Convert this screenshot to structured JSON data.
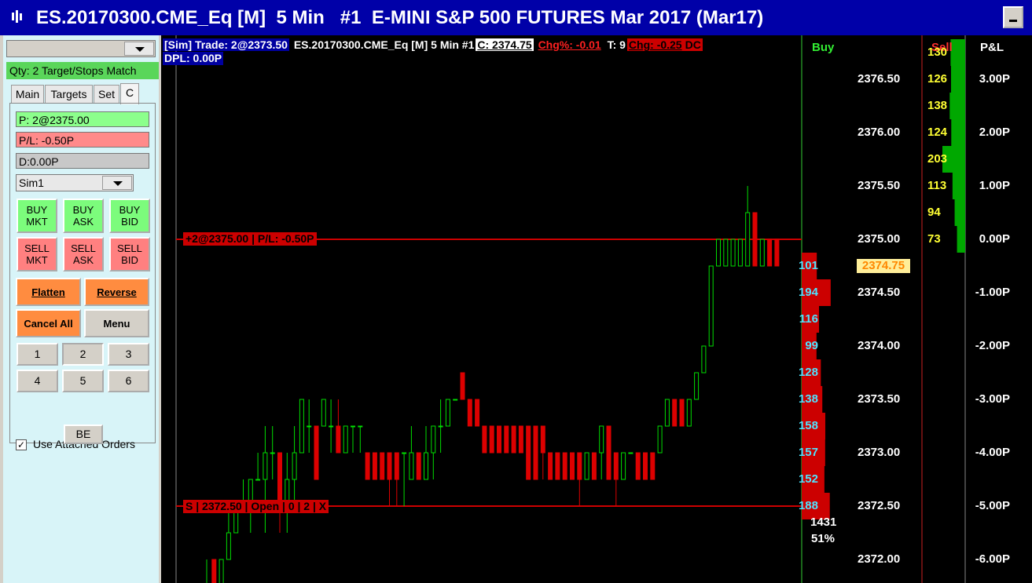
{
  "title": {
    "text": "ES.20170300.CME_Eq [M]  5 Min   #1  E-MINI S&P 500 FUTURES Mar 2017 (Mar17)"
  },
  "panel": {
    "qty_bar": "Qty: 2 Target/Stops Match",
    "tabs": [
      "Main",
      "Targets",
      "Set",
      "C"
    ],
    "position": "P: 2@2375.00",
    "pl": "P/L: -0.50P",
    "daily": "D:0.00P",
    "account": "Sim1",
    "buttons": {
      "buy_mkt": "BUY\nMKT",
      "buy_ask": "BUY\nASK",
      "buy_bid": "BUY\nBID",
      "sell_mkt": "SELL\nMKT",
      "sell_ask": "SELL\nASK",
      "sell_bid": "SELL\nBID",
      "flatten": "Flatten",
      "reverse": "Reverse",
      "cancel_all": "Cancel All",
      "menu": "Menu",
      "be": "BE"
    },
    "numbers": [
      "1",
      "2",
      "3",
      "4",
      "5",
      "6"
    ],
    "use_attached": "Use Attached Orders",
    "checkmark": "✓"
  },
  "chart": {
    "info": {
      "sim": "[Sim]",
      "trade": "Trade: 2@2373.50",
      "symbol": "ES.20170300.CME_Eq [M]  5 Min   #1",
      "close": "C: 2374.75",
      "chg_pct": "Chg%: -0.01",
      "ticks": "T: 9",
      "chg": "Chg: -0.25",
      "dc": "DC",
      "dpl": "DPL: 0.00P"
    },
    "position_line_label": "+2@2375.00 | P/L: -0.50P",
    "stop_line_label": "S | 2372.50 | Open | 0 | 2 | X",
    "headers": {
      "buy": "Buy",
      "sell": "Sell",
      "pnl": "P&L"
    },
    "current_price": "2374.75",
    "volume_total": "1431",
    "volume_pct": "51%",
    "colors": {
      "up": "#00dd00",
      "down": "#dd0000",
      "position_line": "#cc0000",
      "buy_volume": "#cc0000",
      "sell_volume": "#00a800"
    }
  },
  "chart_data": {
    "type": "candlestick",
    "price_ticks": [
      "2376.50",
      "2376.00",
      "2375.50",
      "2375.00",
      "2374.50",
      "2374.00",
      "2373.50",
      "2373.00",
      "2372.50",
      "2372.00"
    ],
    "pnl_ticks": [
      "3.00P",
      "2.00P",
      "1.00P",
      "0.00P",
      "-1.00P",
      "-2.00P",
      "-3.00P",
      "-4.00P",
      "-5.00P",
      "-6.00P"
    ],
    "buy_volume": [
      {
        "price": 2374.75,
        "volume": 101
      },
      {
        "price": 2374.5,
        "volume": 194
      },
      {
        "price": 2374.25,
        "volume": 116
      },
      {
        "price": 2374.0,
        "volume": 99
      },
      {
        "price": 2373.75,
        "volume": 128
      },
      {
        "price": 2373.5,
        "volume": 138
      },
      {
        "price": 2373.25,
        "volume": 158
      },
      {
        "price": 2373.0,
        "volume": 157
      },
      {
        "price": 2372.75,
        "volume": 152
      },
      {
        "price": 2372.5,
        "volume": 188
      }
    ],
    "sell_volume": [
      {
        "price": 2376.75,
        "volume": 130
      },
      {
        "price": 2376.5,
        "volume": 126
      },
      {
        "price": 2376.25,
        "volume": 138
      },
      {
        "price": 2376.0,
        "volume": 124
      },
      {
        "price": 2375.75,
        "volume": 203
      },
      {
        "price": 2375.5,
        "volume": 113
      },
      {
        "price": 2375.25,
        "volume": 94
      },
      {
        "price": 2375.0,
        "volume": 73
      }
    ],
    "position_price": 2375.0,
    "stop_price": 2372.5,
    "candles": [
      {
        "o": 2371.75,
        "h": 2372.0,
        "l": 2371.75,
        "c": 2371.75
      },
      {
        "o": 2372.0,
        "h": 2372.0,
        "l": 2371.75,
        "c": 2371.75
      },
      {
        "o": 2371.75,
        "h": 2372.0,
        "l": 2371.75,
        "c": 2372.0
      },
      {
        "o": 2372.0,
        "h": 2372.5,
        "l": 2372.0,
        "c": 2372.25
      },
      {
        "o": 2372.25,
        "h": 2372.5,
        "l": 2372.25,
        "c": 2372.5
      },
      {
        "o": 2372.5,
        "h": 2372.75,
        "l": 2372.5,
        "c": 2372.5
      },
      {
        "o": 2372.5,
        "h": 2372.75,
        "l": 2372.25,
        "c": 2372.75
      },
      {
        "o": 2372.75,
        "h": 2373.0,
        "l": 2372.75,
        "c": 2372.75
      },
      {
        "o": 2372.75,
        "h": 2373.25,
        "l": 2372.25,
        "c": 2373.0
      },
      {
        "o": 2373.0,
        "h": 2373.25,
        "l": 2372.75,
        "c": 2373.0
      },
      {
        "o": 2373.0,
        "h": 2373.0,
        "l": 2372.25,
        "c": 2372.5
      },
      {
        "o": 2372.5,
        "h": 2373.0,
        "l": 2372.25,
        "c": 2372.75
      },
      {
        "o": 2372.75,
        "h": 2373.25,
        "l": 2372.5,
        "c": 2373.0
      },
      {
        "o": 2373.0,
        "h": 2373.5,
        "l": 2373.0,
        "c": 2373.5
      },
      {
        "o": 2373.25,
        "h": 2373.5,
        "l": 2373.0,
        "c": 2373.25
      },
      {
        "o": 2373.25,
        "h": 2373.25,
        "l": 2372.75,
        "c": 2372.75
      },
      {
        "o": 2373.25,
        "h": 2373.5,
        "l": 2373.25,
        "c": 2373.5
      },
      {
        "o": 2373.25,
        "h": 2373.5,
        "l": 2373.0,
        "c": 2373.25
      },
      {
        "o": 2373.25,
        "h": 2373.5,
        "l": 2373.0,
        "c": 2373.0
      },
      {
        "o": 2373.0,
        "h": 2373.25,
        "l": 2373.0,
        "c": 2373.25
      },
      {
        "o": 2373.25,
        "h": 2373.25,
        "l": 2373.0,
        "c": 2373.25
      },
      {
        "o": 2373.25,
        "h": 2373.25,
        "l": 2373.0,
        "c": 2373.25
      },
      {
        "o": 2373.0,
        "h": 2373.0,
        "l": 2372.75,
        "c": 2372.75
      },
      {
        "o": 2373.0,
        "h": 2373.0,
        "l": 2372.75,
        "c": 2372.75
      },
      {
        "o": 2373.0,
        "h": 2373.0,
        "l": 2372.75,
        "c": 2372.75
      },
      {
        "o": 2373.0,
        "h": 2373.0,
        "l": 2372.5,
        "c": 2372.75
      },
      {
        "o": 2373.0,
        "h": 2373.0,
        "l": 2372.5,
        "c": 2372.75
      },
      {
        "o": 2373.0,
        "h": 2373.0,
        "l": 2372.5,
        "c": 2373.0
      },
      {
        "o": 2372.75,
        "h": 2373.25,
        "l": 2372.75,
        "c": 2373.0
      },
      {
        "o": 2373.0,
        "h": 2373.0,
        "l": 2372.75,
        "c": 2372.75
      },
      {
        "o": 2372.75,
        "h": 2373.25,
        "l": 2372.75,
        "c": 2373.0
      },
      {
        "o": 2373.0,
        "h": 2373.25,
        "l": 2372.75,
        "c": 2373.25
      },
      {
        "o": 2373.25,
        "h": 2373.5,
        "l": 2373.0,
        "c": 2373.25
      },
      {
        "o": 2373.25,
        "h": 2373.5,
        "l": 2373.25,
        "c": 2373.5
      },
      {
        "o": 2373.5,
        "h": 2373.5,
        "l": 2373.5,
        "c": 2373.5
      },
      {
        "o": 2373.75,
        "h": 2373.75,
        "l": 2373.5,
        "c": 2373.5
      },
      {
        "o": 2373.5,
        "h": 2373.5,
        "l": 2373.25,
        "c": 2373.25
      },
      {
        "o": 2373.5,
        "h": 2373.5,
        "l": 2373.25,
        "c": 2373.25
      },
      {
        "o": 2373.25,
        "h": 2373.25,
        "l": 2373.0,
        "c": 2373.0
      },
      {
        "o": 2373.25,
        "h": 2373.25,
        "l": 2373.0,
        "c": 2373.0
      },
      {
        "o": 2373.25,
        "h": 2373.25,
        "l": 2373.0,
        "c": 2373.0
      },
      {
        "o": 2373.25,
        "h": 2373.25,
        "l": 2373.0,
        "c": 2373.0
      },
      {
        "o": 2373.25,
        "h": 2373.25,
        "l": 2373.0,
        "c": 2373.0
      },
      {
        "o": 2373.25,
        "h": 2373.25,
        "l": 2373.0,
        "c": 2373.0
      },
      {
        "o": 2373.25,
        "h": 2373.25,
        "l": 2372.75,
        "c": 2372.75
      },
      {
        "o": 2373.25,
        "h": 2373.25,
        "l": 2372.75,
        "c": 2372.75
      },
      {
        "o": 2373.25,
        "h": 2373.25,
        "l": 2372.75,
        "c": 2373.0
      },
      {
        "o": 2373.0,
        "h": 2373.0,
        "l": 2372.75,
        "c": 2372.75
      },
      {
        "o": 2373.0,
        "h": 2373.0,
        "l": 2372.75,
        "c": 2372.75
      },
      {
        "o": 2373.0,
        "h": 2373.0,
        "l": 2372.75,
        "c": 2372.75
      },
      {
        "o": 2373.0,
        "h": 2373.0,
        "l": 2372.75,
        "c": 2372.75
      },
      {
        "o": 2373.0,
        "h": 2373.0,
        "l": 2372.5,
        "c": 2372.75
      },
      {
        "o": 2372.75,
        "h": 2373.0,
        "l": 2372.75,
        "c": 2373.0
      },
      {
        "o": 2373.0,
        "h": 2373.0,
        "l": 2372.75,
        "c": 2372.75
      },
      {
        "o": 2373.0,
        "h": 2373.25,
        "l": 2372.75,
        "c": 2373.25
      },
      {
        "o": 2373.25,
        "h": 2373.25,
        "l": 2372.75,
        "c": 2372.75
      },
      {
        "o": 2373.0,
        "h": 2373.0,
        "l": 2372.5,
        "c": 2372.75
      },
      {
        "o": 2372.75,
        "h": 2373.0,
        "l": 2372.75,
        "c": 2373.0
      },
      {
        "o": 2373.0,
        "h": 2373.0,
        "l": 2373.0,
        "c": 2373.0
      },
      {
        "o": 2373.0,
        "h": 2373.0,
        "l": 2372.75,
        "c": 2372.75
      },
      {
        "o": 2373.0,
        "h": 2373.0,
        "l": 2372.75,
        "c": 2372.75
      },
      {
        "o": 2373.0,
        "h": 2373.0,
        "l": 2372.75,
        "c": 2372.75
      },
      {
        "o": 2373.0,
        "h": 2373.25,
        "l": 2373.0,
        "c": 2373.25
      },
      {
        "o": 2373.25,
        "h": 2373.5,
        "l": 2373.25,
        "c": 2373.5
      },
      {
        "o": 2373.5,
        "h": 2373.5,
        "l": 2373.25,
        "c": 2373.25
      },
      {
        "o": 2373.5,
        "h": 2373.5,
        "l": 2373.25,
        "c": 2373.25
      },
      {
        "o": 2373.25,
        "h": 2373.5,
        "l": 2373.25,
        "c": 2373.5
      },
      {
        "o": 2373.5,
        "h": 2373.75,
        "l": 2373.5,
        "c": 2373.75
      },
      {
        "o": 2373.75,
        "h": 2374.0,
        "l": 2373.75,
        "c": 2374.0
      },
      {
        "o": 2374.0,
        "h": 2374.75,
        "l": 2374.0,
        "c": 2374.75
      },
      {
        "o": 2374.75,
        "h": 2375.0,
        "l": 2374.75,
        "c": 2375.0
      },
      {
        "o": 2374.75,
        "h": 2375.0,
        "l": 2374.75,
        "c": 2375.0
      },
      {
        "o": 2374.75,
        "h": 2375.0,
        "l": 2374.75,
        "c": 2375.0
      },
      {
        "o": 2374.75,
        "h": 2375.0,
        "l": 2374.75,
        "c": 2375.0
      },
      {
        "o": 2374.75,
        "h": 2375.5,
        "l": 2374.75,
        "c": 2375.25
      },
      {
        "o": 2375.25,
        "h": 2375.25,
        "l": 2374.75,
        "c": 2374.75
      },
      {
        "o": 2374.75,
        "h": 2375.0,
        "l": 2374.75,
        "c": 2375.0
      },
      {
        "o": 2375.0,
        "h": 2375.0,
        "l": 2374.75,
        "c": 2374.75
      },
      {
        "o": 2375.0,
        "h": 2375.0,
        "l": 2374.75,
        "c": 2374.75
      }
    ]
  }
}
